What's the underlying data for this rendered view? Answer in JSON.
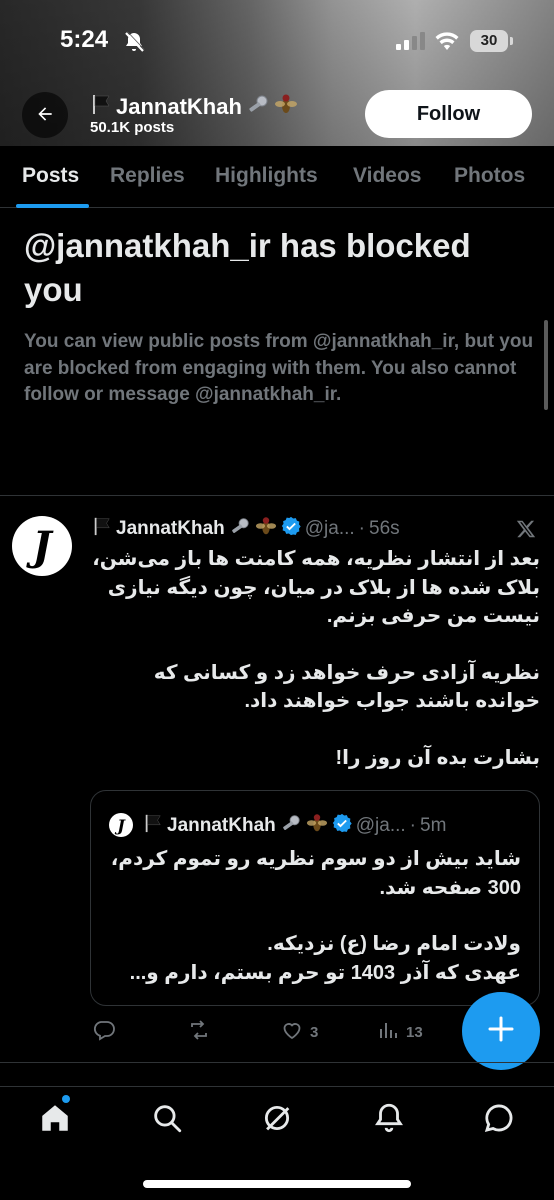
{
  "status_bar": {
    "time": "5:24",
    "battery": "30"
  },
  "profile": {
    "name": "JannatKhah",
    "posts_count": "50.1K posts",
    "follow_label": "Follow"
  },
  "tabs": [
    {
      "label": "Posts",
      "active": true
    },
    {
      "label": "Replies",
      "active": false
    },
    {
      "label": "Highlights",
      "active": false
    },
    {
      "label": "Videos",
      "active": false
    },
    {
      "label": "Photos",
      "active": false
    }
  ],
  "blocked": {
    "title": "@jannatkhah_ir has blocked you",
    "description": "You can view public posts from @jannatkhah_ir, but you are blocked from engaging with them. You also cannot follow or message @jannatkhah_ir."
  },
  "tweet": {
    "name": "JannatKhah",
    "handle": "@ja...",
    "separator": "·",
    "time": "56s",
    "paragraphs": [
      "بعد از انتشار نظریه، همه کامنت ها باز می‌شن، بلاک شده ها از بلاک در میان، چون دیگه نیازی نیست من حرفی بزنم.",
      "نظریه آزادی حرف خواهد زد و کسانی که خوانده باشند جواب خواهند داد.",
      "بشارت بده آن روز را!"
    ],
    "quote": {
      "name": "JannatKhah",
      "handle": "@ja...",
      "separator": "·",
      "time": "5m",
      "paragraphs": [
        "شاید بیش از دو سوم نظریه رو تموم کردم، 300 صفحه شد.",
        "ولادت امام رضا (ع) نزدیکه.\nعهدی که آذر 1403 تو حرم بستم، دارم و..."
      ]
    },
    "actions": {
      "replies": "",
      "reposts": "",
      "likes": "3",
      "views": "13"
    }
  },
  "icons": {
    "back": "arrow-left-icon",
    "verified": "verified-badge-icon",
    "x_logo": "x-logo-icon",
    "compose": "plus-icon",
    "nav": [
      "home-icon",
      "search-icon",
      "grok-icon",
      "notifications-icon",
      "messages-icon"
    ]
  },
  "colors": {
    "accent": "#1d9bf0",
    "background": "#000000",
    "muted": "#71767b",
    "text": "#e7e9ea"
  }
}
